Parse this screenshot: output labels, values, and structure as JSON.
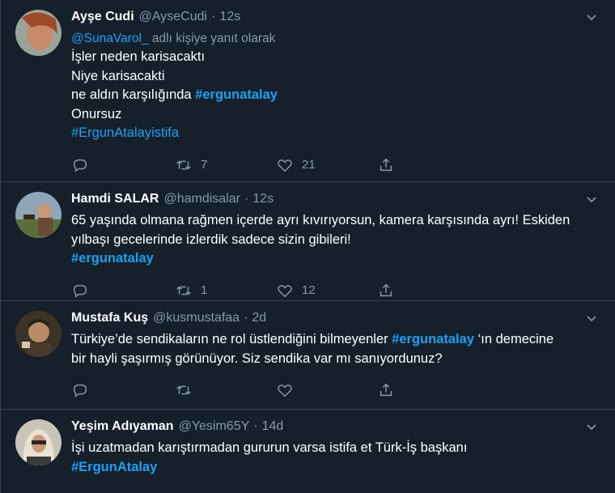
{
  "tweets": [
    {
      "name": "Ayşe Cudi",
      "handle": "@AyseCudi",
      "dot": "·",
      "time": "12s",
      "reply_mention": "@SunaVarol_",
      "reply_suffix": " adlı kişiye yanıt olarak",
      "lines": [
        "İşler neden karisacaktı",
        "Niye karisacakti"
      ],
      "line3_text": "ne aldın karşılığında ",
      "line3_tag": "#ergunatalay",
      "line4": "Onursuz",
      "line5_tag": "#ErgunAtalayistifa",
      "retweets": "7",
      "likes": "21"
    },
    {
      "name": "Hamdi SALAR",
      "handle": "@hamdisalar",
      "dot": "·",
      "time": "12s",
      "line1": "65 yaşında olmana rağmen içerde ayrı kıvırıyorsun, kamera karşısında ayrı! Eskiden",
      "line2": "yılbaşı gecelerinde izlerdik sadece sizin gibileri!",
      "tag": "#ergunatalay",
      "retweets": "1",
      "likes": "12"
    },
    {
      "name": "Mustafa Kuş",
      "handle": "@kusmustafaa",
      "dot": "·",
      "time": "2d",
      "line1_text": "Türkiye’de sendikaların ne rol üstlendiğini bilmeyenler ",
      "line1_tag": "#ergunatalay",
      "line1_after": " ‘ın demecine",
      "line2": "bir hayli şaşırmış görünüyor. Siz sendika var mı sanıyordunuz?",
      "retweets": "",
      "likes": ""
    },
    {
      "name": "Yeşim Adıyaman",
      "handle": "@Yesim65Y",
      "dot": "·",
      "time": "14d",
      "line1": "İşi uzatmadan karıştırmadan gururun varsa istifa et Türk-İş başkanı",
      "tag": "#ErgunAtalay"
    }
  ],
  "icons": {
    "reply": "reply-icon",
    "retweet": "retweet-icon",
    "like": "heart-icon",
    "share": "share-icon",
    "more": "chevron-down-icon"
  },
  "colors": {
    "background": "#15202b",
    "border": "#38444d",
    "text": "#ffffff",
    "secondary": "#8899a6",
    "accent": "#1da1f2"
  }
}
